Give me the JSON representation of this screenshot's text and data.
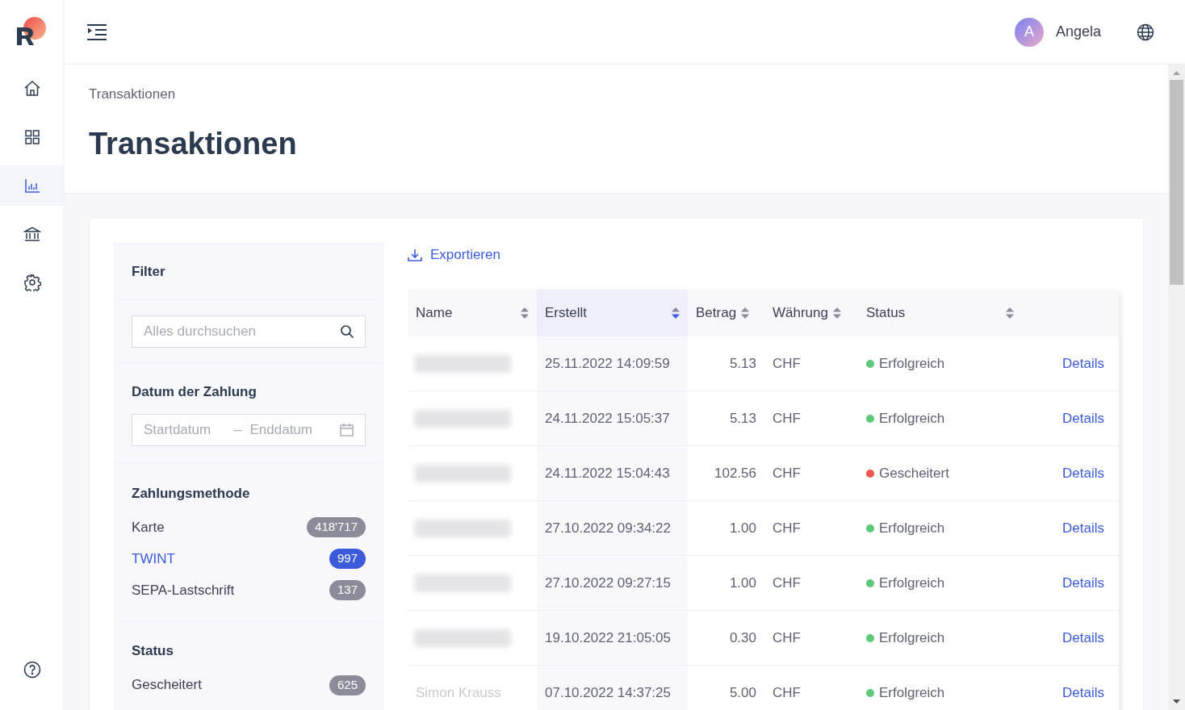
{
  "nav": [
    {
      "kind": "home",
      "selected": false
    },
    {
      "kind": "grid",
      "selected": false
    },
    {
      "kind": "chart",
      "selected": true
    },
    {
      "kind": "bank",
      "selected": false
    },
    {
      "kind": "settings",
      "selected": false
    }
  ],
  "user": {
    "initial": "A",
    "name": "Angela"
  },
  "breadcrumb": "Transaktionen",
  "title": "Transaktionen",
  "filter": {
    "title": "Filter",
    "search_placeholder": "Alles durchsuchen",
    "date": {
      "label": "Datum der Zahlung",
      "start_placeholder": "Startdatum",
      "separator": "–",
      "end_placeholder": "Enddatum"
    },
    "groups": [
      {
        "title": "Zahlungsmethode",
        "items": [
          {
            "label": "Karte",
            "count": "418'717",
            "selected": false
          },
          {
            "label": "TWINT",
            "count": "997",
            "selected": true
          },
          {
            "label": "SEPA-Lastschrift",
            "count": "137",
            "selected": false
          }
        ]
      },
      {
        "title": "Status",
        "items": [
          {
            "label": "Gescheitert",
            "count": "625",
            "selected": false
          }
        ]
      }
    ]
  },
  "export": "Exportieren",
  "table": {
    "columns": [
      {
        "label": "Name",
        "sorted": false
      },
      {
        "label": "Erstellt",
        "sorted": true
      },
      {
        "label": "Betrag",
        "sorted": false
      },
      {
        "label": "Währung",
        "sorted": false
      },
      {
        "label": "Status",
        "sorted": false
      }
    ],
    "rows": [
      {
        "redacted": true,
        "created": "25.11.2022 14:09:59",
        "amount": "5.13",
        "currency": "CHF",
        "status": "Erfolgreich",
        "color": "#5cc87a",
        "action": "Details"
      },
      {
        "redacted": true,
        "created": "24.11.2022 15:05:37",
        "amount": "5.13",
        "currency": "CHF",
        "status": "Erfolgreich",
        "color": "#5cc87a",
        "action": "Details"
      },
      {
        "redacted": true,
        "created": "24.11.2022 15:04:43",
        "amount": "102.56",
        "currency": "CHF",
        "status": "Gescheitert",
        "color": "#f0554d",
        "action": "Details"
      },
      {
        "redacted": true,
        "created": "27.10.2022 09:34:22",
        "amount": "1.00",
        "currency": "CHF",
        "status": "Erfolgreich",
        "color": "#5cc87a",
        "action": "Details"
      },
      {
        "redacted": true,
        "created": "27.10.2022 09:27:15",
        "amount": "1.00",
        "currency": "CHF",
        "status": "Erfolgreich",
        "color": "#5cc87a",
        "action": "Details"
      },
      {
        "redacted": true,
        "created": "19.10.2022 21:05:05",
        "amount": "0.30",
        "currency": "CHF",
        "status": "Erfolgreich",
        "color": "#5cc87a",
        "action": "Details"
      },
      {
        "redacted": false,
        "name": "Simon Krauss",
        "created": "07.10.2022 14:37:25",
        "amount": "5.00",
        "currency": "CHF",
        "status": "Erfolgreich",
        "color": "#5cc87a",
        "action": "Details"
      }
    ]
  }
}
